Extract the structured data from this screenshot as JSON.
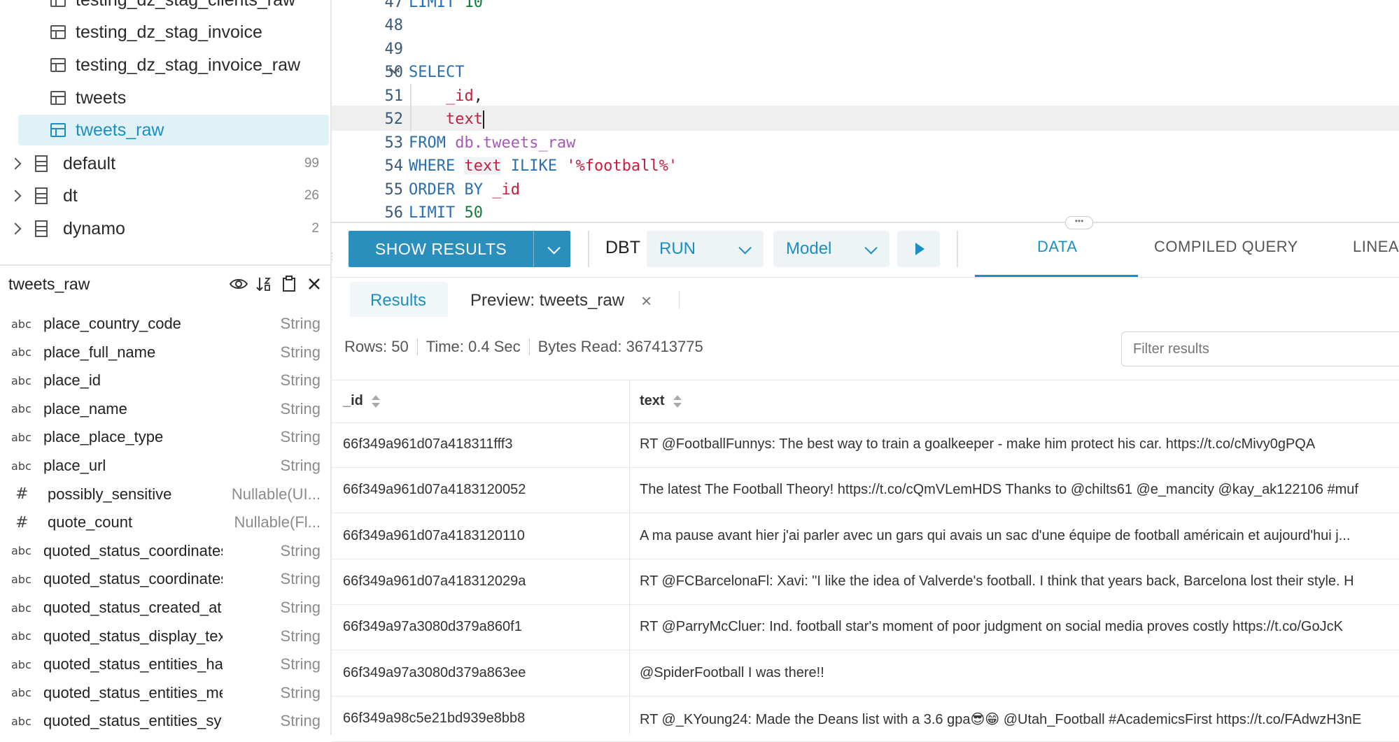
{
  "tree": {
    "partial_top": "testing_dz_stag_clients_raw",
    "tables": [
      "testing_dz_stag_invoice",
      "testing_dz_stag_invoice_raw",
      "tweets",
      "tweets_raw"
    ],
    "databases": [
      {
        "name": "default",
        "count": "99"
      },
      {
        "name": "dt",
        "count": "26"
      },
      {
        "name": "dynamo",
        "count": "2"
      }
    ]
  },
  "schema": {
    "title": "tweets_raw",
    "columns": [
      {
        "icon": "abc",
        "name": "place_country_code",
        "type": "String"
      },
      {
        "icon": "abc",
        "name": "place_full_name",
        "type": "String"
      },
      {
        "icon": "abc",
        "name": "place_id",
        "type": "String"
      },
      {
        "icon": "abc",
        "name": "place_name",
        "type": "String"
      },
      {
        "icon": "abc",
        "name": "place_place_type",
        "type": "String"
      },
      {
        "icon": "abc",
        "name": "place_url",
        "type": "String"
      },
      {
        "icon": "#",
        "name": "possibly_sensitive",
        "type": "Nullable(UI..."
      },
      {
        "icon": "#",
        "name": "quote_count",
        "type": "Nullable(Fl..."
      },
      {
        "icon": "abc",
        "name": "quoted_status_coordinates_c...",
        "type": "String"
      },
      {
        "icon": "abc",
        "name": "quoted_status_coordinates_t...",
        "type": "String"
      },
      {
        "icon": "abc",
        "name": "quoted_status_created_at",
        "type": "String"
      },
      {
        "icon": "abc",
        "name": "quoted_status_display_text_r...",
        "type": "String"
      },
      {
        "icon": "abc",
        "name": "quoted_status_entities_hasht...",
        "type": "String"
      },
      {
        "icon": "abc",
        "name": "quoted_status_entities_media",
        "type": "String"
      },
      {
        "icon": "abc",
        "name": "quoted_status_entities_symb...",
        "type": "String"
      }
    ]
  },
  "editor": {
    "line_numbers": [
      "47",
      "48",
      "49",
      "50",
      "51",
      "52",
      "53",
      "54",
      "55",
      "56"
    ],
    "l47": {
      "kw": "LIMIT",
      "num": "10"
    },
    "l50": {
      "kw": "SELECT"
    },
    "l51": {
      "id": "_id",
      "pl": ","
    },
    "l52": {
      "id": "text"
    },
    "l53": {
      "kw": "FROM",
      "tb": "db.tweets_raw"
    },
    "l54": {
      "kw": "WHERE",
      "id": "text",
      "kw2": "ILIKE",
      "str": "'%football%'"
    },
    "l55": {
      "kw": "ORDER BY",
      "id": "_id"
    },
    "l56": {
      "kw": "LIMIT",
      "num": "50"
    }
  },
  "toolbar": {
    "show_results": "SHOW RESULTS",
    "dbt": "DBT",
    "run": "RUN",
    "model": "Model",
    "tabs": [
      "DATA",
      "COMPILED QUERY",
      "LINEA"
    ]
  },
  "subtabs": {
    "results": "Results",
    "preview": "Preview: tweets_raw"
  },
  "stats": {
    "rows": "Rows: 50",
    "time": "Time: 0.4 Sec",
    "bytes": "Bytes Read: 367413775"
  },
  "filter": {
    "placeholder": "Filter results"
  },
  "table": {
    "headers": [
      "_id",
      "text"
    ],
    "rows": [
      {
        "id": "66f349a961d07a418311fff3",
        "text": "RT @FootballFunnys: The best way to train a goalkeeper - make him protect his car. https://t.co/cMivy0gPQA"
      },
      {
        "id": "66f349a961d07a4183120052",
        "text": "The latest The Football Theory! https://t.co/cQmVLemHDS Thanks to @chilts61 @e_mancity @kay_ak122106 #muf"
      },
      {
        "id": "66f349a961d07a4183120110",
        "text": "A ma pause avant hier j'ai parler avec un gars qui avais un sac d'une équipe de football américain et aujourd'hui j..."
      },
      {
        "id": "66f349a961d07a418312029a",
        "text": "RT @FCBarcelonaFl: Xavi: \"I like the idea of Valverde's football. I think that years back, Barcelona lost their style. H"
      },
      {
        "id": "66f349a97a3080d379a860f1",
        "text": "RT @ParryMcCluer: Ind. football star's moment of poor judgment on social media proves costly https://t.co/GoJcK"
      },
      {
        "id": "66f349a97a3080d379a863ee",
        "text": "@SpiderFootball I was there!!"
      },
      {
        "id": "66f349a98c5e21bd939e8bb8",
        "text": "RT @_KYoung24: Made the Deans list with a 3.6 gpa😎😁 @Utah_Football #AcademicsFirst https://t.co/FAdwzH3nE"
      }
    ]
  }
}
